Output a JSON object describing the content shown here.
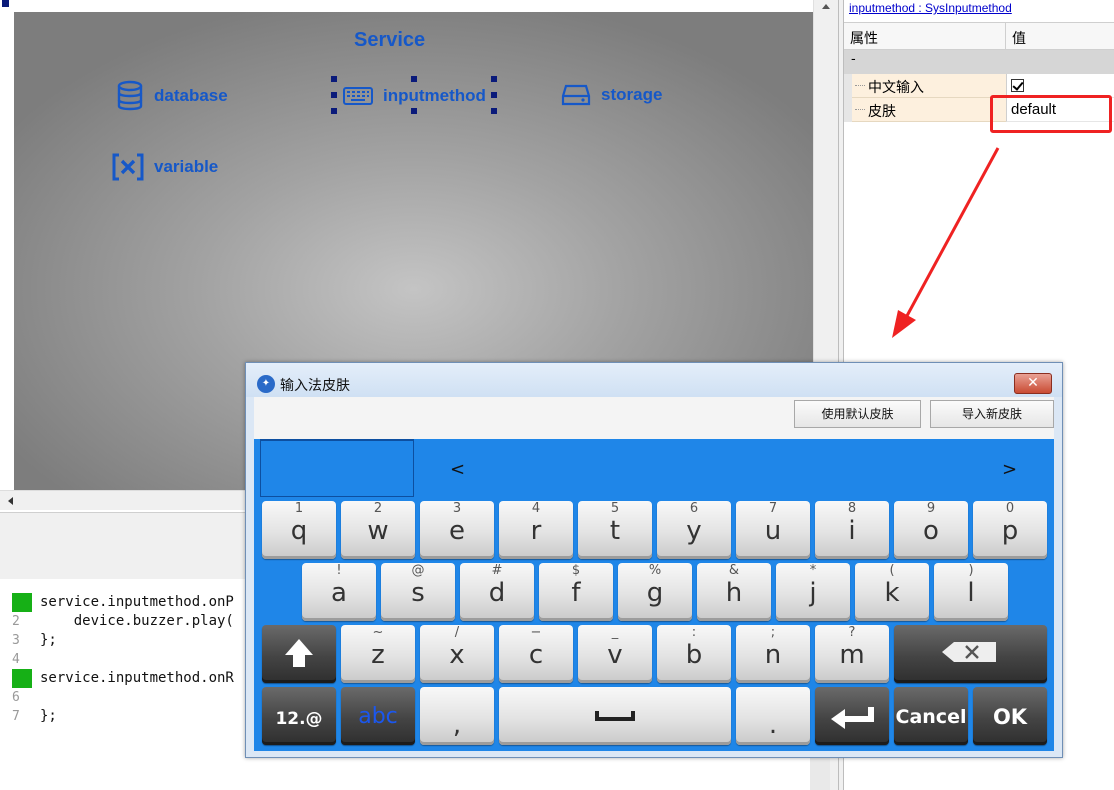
{
  "designer": {
    "service_title": "Service",
    "items": [
      {
        "label": "database"
      },
      {
        "label": "inputmethod"
      },
      {
        "label": "storage"
      },
      {
        "label": "variable"
      }
    ],
    "accent_color": "#1658c8"
  },
  "editor": {
    "lines": [
      {
        "num": "1",
        "text": "service.inputmethod.onP",
        "marker": true
      },
      {
        "num": "2",
        "text": "    device.buzzer.play(",
        "marker": false
      },
      {
        "num": "3",
        "text": "};",
        "marker": false
      },
      {
        "num": "4",
        "text": "",
        "marker": false
      },
      {
        "num": "5",
        "text": "service.inputmethod.onR",
        "marker": true
      },
      {
        "num": "6",
        "text": "",
        "marker": false
      },
      {
        "num": "7",
        "text": "};",
        "marker": false
      }
    ]
  },
  "properties": {
    "title": "inputmethod : SysInputmethod",
    "header_name": "属性",
    "header_value": "值",
    "group_label": "-",
    "rows": [
      {
        "name": "中文输入",
        "checked": true
      },
      {
        "name": "皮肤",
        "value": "default"
      }
    ]
  },
  "dialog": {
    "title": "输入法皮肤",
    "close_label": "✕",
    "use_default_button": "使用默认皮肤",
    "import_button": "导入新皮肤",
    "cand_prev": "<",
    "cand_next": ">",
    "keyboard": {
      "background": "#1f86e8",
      "row1": [
        {
          "main": "q",
          "sub": "1"
        },
        {
          "main": "w",
          "sub": "2"
        },
        {
          "main": "e",
          "sub": "3"
        },
        {
          "main": "r",
          "sub": "4"
        },
        {
          "main": "t",
          "sub": "5"
        },
        {
          "main": "y",
          "sub": "6"
        },
        {
          "main": "u",
          "sub": "7"
        },
        {
          "main": "i",
          "sub": "8"
        },
        {
          "main": "o",
          "sub": "9"
        },
        {
          "main": "p",
          "sub": "0"
        }
      ],
      "row2": [
        {
          "main": "a",
          "sub": "!"
        },
        {
          "main": "s",
          "sub": "@"
        },
        {
          "main": "d",
          "sub": "#"
        },
        {
          "main": "f",
          "sub": "$"
        },
        {
          "main": "g",
          "sub": "%"
        },
        {
          "main": "h",
          "sub": "&"
        },
        {
          "main": "j",
          "sub": "*"
        },
        {
          "main": "k",
          "sub": "("
        },
        {
          "main": "l",
          "sub": ")"
        }
      ],
      "row3": [
        {
          "main": "z",
          "sub": "~"
        },
        {
          "main": "x",
          "sub": "/"
        },
        {
          "main": "c",
          "sub": "−"
        },
        {
          "main": "v",
          "sub": "_"
        },
        {
          "main": "b",
          "sub": ":"
        },
        {
          "main": "n",
          "sub": ";"
        },
        {
          "main": "m",
          "sub": "?"
        }
      ],
      "num_key": "12.@",
      "abc_key": "abc",
      "comma_key": ",",
      "period_key": ".",
      "cancel_key": "Cancel",
      "ok_key": "OK"
    }
  }
}
